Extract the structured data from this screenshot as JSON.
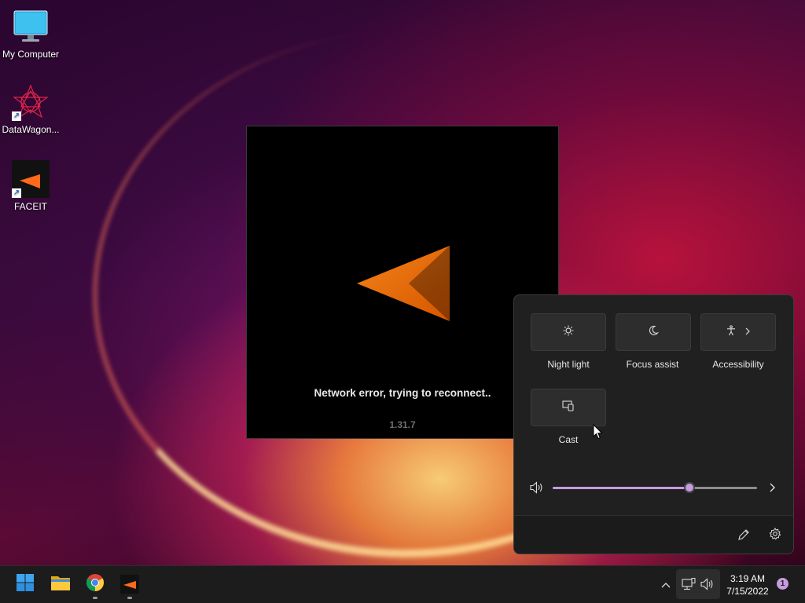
{
  "desktop": {
    "icons": [
      {
        "label": "My Computer"
      },
      {
        "label": "DataWagon..."
      },
      {
        "label": "FACEIT"
      }
    ]
  },
  "faceit_window": {
    "status": "Network error, trying to reconnect..",
    "version": "1.31.7"
  },
  "quick_settings": {
    "tiles": [
      {
        "label": "Night light",
        "icon": "night-light-icon"
      },
      {
        "label": "Focus assist",
        "icon": "moon-icon"
      },
      {
        "label": "Accessibility",
        "icon": "accessibility-icon"
      },
      {
        "label": "Cast",
        "icon": "cast-icon"
      }
    ],
    "volume_level_percent": 67,
    "accent_color": "#c79be0"
  },
  "taskbar": {
    "apps": [
      "start-icon",
      "file-explorer-icon",
      "chrome-icon",
      "faceit-icon"
    ],
    "clock": {
      "time": "3:19 AM",
      "date": "7/15/2022"
    },
    "notification_count": "1"
  }
}
